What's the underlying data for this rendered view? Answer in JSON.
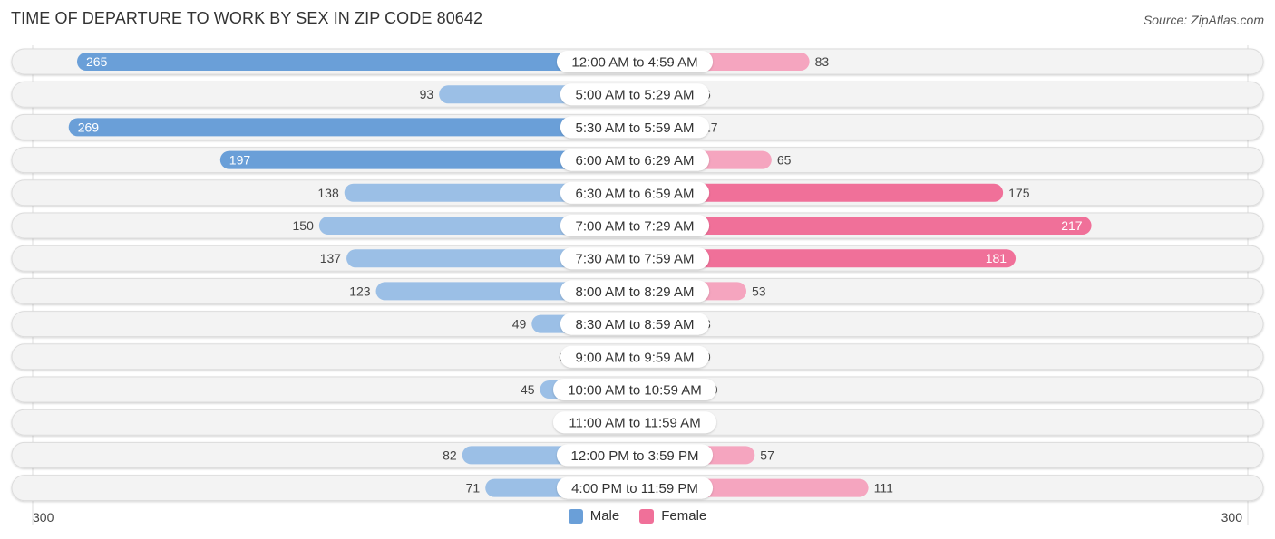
{
  "title": "TIME OF DEPARTURE TO WORK BY SEX IN ZIP CODE 80642",
  "source": "Source: ZipAtlas.com",
  "colors": {
    "male": "#6a9fd8",
    "male_light": "#9bbfe6",
    "female": "#f07099",
    "female_light": "#f5a5bf",
    "row_bg": "#f2f2f2"
  },
  "chart_data": {
    "type": "bar",
    "orientation": "horizontal-diverging",
    "title": "TIME OF DEPARTURE TO WORK BY SEX IN ZIP CODE 80642",
    "categories": [
      "12:00 AM to 4:59 AM",
      "5:00 AM to 5:29 AM",
      "5:30 AM to 5:59 AM",
      "6:00 AM to 6:29 AM",
      "6:30 AM to 6:59 AM",
      "7:00 AM to 7:29 AM",
      "7:30 AM to 7:59 AM",
      "8:00 AM to 8:29 AM",
      "8:30 AM to 8:59 AM",
      "9:00 AM to 9:59 AM",
      "10:00 AM to 10:59 AM",
      "11:00 AM to 11:59 AM",
      "12:00 PM to 3:59 PM",
      "4:00 PM to 11:59 PM"
    ],
    "series": [
      {
        "name": "Male",
        "values": [
          265,
          93,
          269,
          197,
          138,
          150,
          137,
          123,
          49,
          0,
          45,
          0,
          82,
          71
        ]
      },
      {
        "name": "Female",
        "values": [
          83,
          6,
          17,
          65,
          175,
          217,
          181,
          53,
          8,
          9,
          10,
          0,
          57,
          111
        ]
      }
    ],
    "axis": {
      "min_label": "300",
      "max_label": "300",
      "range": [
        300,
        300
      ]
    },
    "legend": {
      "position": "bottom-center",
      "entries": [
        "Male",
        "Female"
      ]
    }
  }
}
